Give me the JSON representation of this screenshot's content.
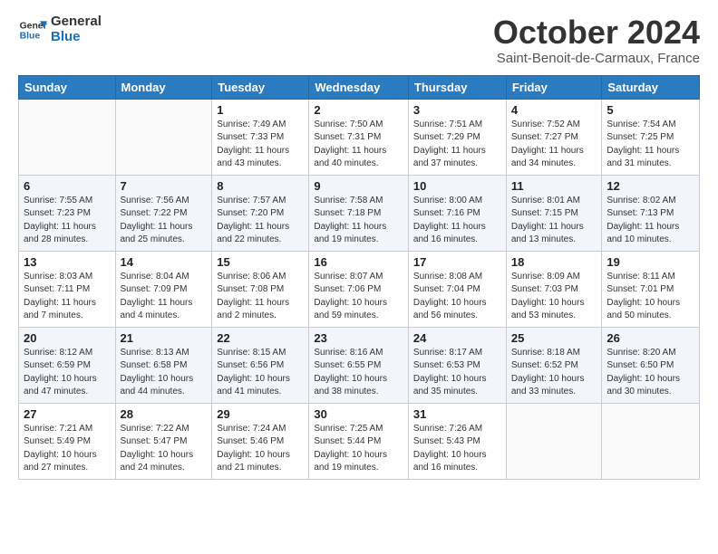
{
  "header": {
    "logo_line1": "General",
    "logo_line2": "Blue",
    "month_title": "October 2024",
    "subtitle": "Saint-Benoit-de-Carmaux, France"
  },
  "weekdays": [
    "Sunday",
    "Monday",
    "Tuesday",
    "Wednesday",
    "Thursday",
    "Friday",
    "Saturday"
  ],
  "weeks": [
    [
      {
        "day": "",
        "content": ""
      },
      {
        "day": "",
        "content": ""
      },
      {
        "day": "1",
        "content": "Sunrise: 7:49 AM\nSunset: 7:33 PM\nDaylight: 11 hours and 43 minutes."
      },
      {
        "day": "2",
        "content": "Sunrise: 7:50 AM\nSunset: 7:31 PM\nDaylight: 11 hours and 40 minutes."
      },
      {
        "day": "3",
        "content": "Sunrise: 7:51 AM\nSunset: 7:29 PM\nDaylight: 11 hours and 37 minutes."
      },
      {
        "day": "4",
        "content": "Sunrise: 7:52 AM\nSunset: 7:27 PM\nDaylight: 11 hours and 34 minutes."
      },
      {
        "day": "5",
        "content": "Sunrise: 7:54 AM\nSunset: 7:25 PM\nDaylight: 11 hours and 31 minutes."
      }
    ],
    [
      {
        "day": "6",
        "content": "Sunrise: 7:55 AM\nSunset: 7:23 PM\nDaylight: 11 hours and 28 minutes."
      },
      {
        "day": "7",
        "content": "Sunrise: 7:56 AM\nSunset: 7:22 PM\nDaylight: 11 hours and 25 minutes."
      },
      {
        "day": "8",
        "content": "Sunrise: 7:57 AM\nSunset: 7:20 PM\nDaylight: 11 hours and 22 minutes."
      },
      {
        "day": "9",
        "content": "Sunrise: 7:58 AM\nSunset: 7:18 PM\nDaylight: 11 hours and 19 minutes."
      },
      {
        "day": "10",
        "content": "Sunrise: 8:00 AM\nSunset: 7:16 PM\nDaylight: 11 hours and 16 minutes."
      },
      {
        "day": "11",
        "content": "Sunrise: 8:01 AM\nSunset: 7:15 PM\nDaylight: 11 hours and 13 minutes."
      },
      {
        "day": "12",
        "content": "Sunrise: 8:02 AM\nSunset: 7:13 PM\nDaylight: 11 hours and 10 minutes."
      }
    ],
    [
      {
        "day": "13",
        "content": "Sunrise: 8:03 AM\nSunset: 7:11 PM\nDaylight: 11 hours and 7 minutes."
      },
      {
        "day": "14",
        "content": "Sunrise: 8:04 AM\nSunset: 7:09 PM\nDaylight: 11 hours and 4 minutes."
      },
      {
        "day": "15",
        "content": "Sunrise: 8:06 AM\nSunset: 7:08 PM\nDaylight: 11 hours and 2 minutes."
      },
      {
        "day": "16",
        "content": "Sunrise: 8:07 AM\nSunset: 7:06 PM\nDaylight: 10 hours and 59 minutes."
      },
      {
        "day": "17",
        "content": "Sunrise: 8:08 AM\nSunset: 7:04 PM\nDaylight: 10 hours and 56 minutes."
      },
      {
        "day": "18",
        "content": "Sunrise: 8:09 AM\nSunset: 7:03 PM\nDaylight: 10 hours and 53 minutes."
      },
      {
        "day": "19",
        "content": "Sunrise: 8:11 AM\nSunset: 7:01 PM\nDaylight: 10 hours and 50 minutes."
      }
    ],
    [
      {
        "day": "20",
        "content": "Sunrise: 8:12 AM\nSunset: 6:59 PM\nDaylight: 10 hours and 47 minutes."
      },
      {
        "day": "21",
        "content": "Sunrise: 8:13 AM\nSunset: 6:58 PM\nDaylight: 10 hours and 44 minutes."
      },
      {
        "day": "22",
        "content": "Sunrise: 8:15 AM\nSunset: 6:56 PM\nDaylight: 10 hours and 41 minutes."
      },
      {
        "day": "23",
        "content": "Sunrise: 8:16 AM\nSunset: 6:55 PM\nDaylight: 10 hours and 38 minutes."
      },
      {
        "day": "24",
        "content": "Sunrise: 8:17 AM\nSunset: 6:53 PM\nDaylight: 10 hours and 35 minutes."
      },
      {
        "day": "25",
        "content": "Sunrise: 8:18 AM\nSunset: 6:52 PM\nDaylight: 10 hours and 33 minutes."
      },
      {
        "day": "26",
        "content": "Sunrise: 8:20 AM\nSunset: 6:50 PM\nDaylight: 10 hours and 30 minutes."
      }
    ],
    [
      {
        "day": "27",
        "content": "Sunrise: 7:21 AM\nSunset: 5:49 PM\nDaylight: 10 hours and 27 minutes."
      },
      {
        "day": "28",
        "content": "Sunrise: 7:22 AM\nSunset: 5:47 PM\nDaylight: 10 hours and 24 minutes."
      },
      {
        "day": "29",
        "content": "Sunrise: 7:24 AM\nSunset: 5:46 PM\nDaylight: 10 hours and 21 minutes."
      },
      {
        "day": "30",
        "content": "Sunrise: 7:25 AM\nSunset: 5:44 PM\nDaylight: 10 hours and 19 minutes."
      },
      {
        "day": "31",
        "content": "Sunrise: 7:26 AM\nSunset: 5:43 PM\nDaylight: 10 hours and 16 minutes."
      },
      {
        "day": "",
        "content": ""
      },
      {
        "day": "",
        "content": ""
      }
    ]
  ]
}
